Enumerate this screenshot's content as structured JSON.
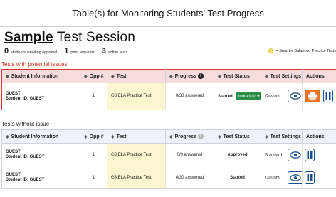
{
  "page": {
    "title": "Table(s) for Monitoring Students' Test Progress",
    "session_title_bold": "Sample",
    "session_title_rest": " Test Session"
  },
  "stats": [
    {
      "num": "0",
      "label": "students awaiting approval"
    },
    {
      "num": "1",
      "label": "print requests"
    },
    {
      "num": "3",
      "label": "active tests"
    }
  ],
  "legend": {
    "label": "= Smarter Balanced Practice Tests",
    "color": "#f2e36b"
  },
  "issues_section": {
    "label": "Tests with potential issues",
    "headers": [
      "Student Information",
      "Opp #",
      "Test",
      "Progress",
      "Test Status",
      "Test Settings",
      "Actions"
    ],
    "rows": [
      {
        "name": "GUEST",
        "student_id": "Student ID: GUEST",
        "opp": "1",
        "test": "G3 ELA Practice Test",
        "progress": "0/30 answered",
        "status": "Started",
        "more_info": "more info ▾",
        "settings": "Custom"
      }
    ]
  },
  "ok_section": {
    "label": "Tests without issue",
    "headers": [
      "Student Information",
      "Opp #",
      "Test",
      "Progress",
      "Test Status",
      "Test Settings",
      "Actions"
    ],
    "rows": [
      {
        "name": "GUEST",
        "student_id": "Student ID: GUEST",
        "opp": "1",
        "test": "G3 ELA Practice Test",
        "progress": "0/0 answered",
        "status": "Approved",
        "settings": "Standard"
      },
      {
        "name": "GUEST",
        "student_id": "Student ID: GUEST",
        "opp": "1",
        "test": "G3 ELA Practice Test",
        "progress": "0/30 answered",
        "status": "Started",
        "settings": "Custom"
      }
    ]
  },
  "colors": {
    "issue_accent": "#d22b2b",
    "practice_highlight": "#fbf6cf",
    "button_blue": "#1b4f8c",
    "print_orange": "#e8742b",
    "more_info_green": "#2d8f47"
  }
}
